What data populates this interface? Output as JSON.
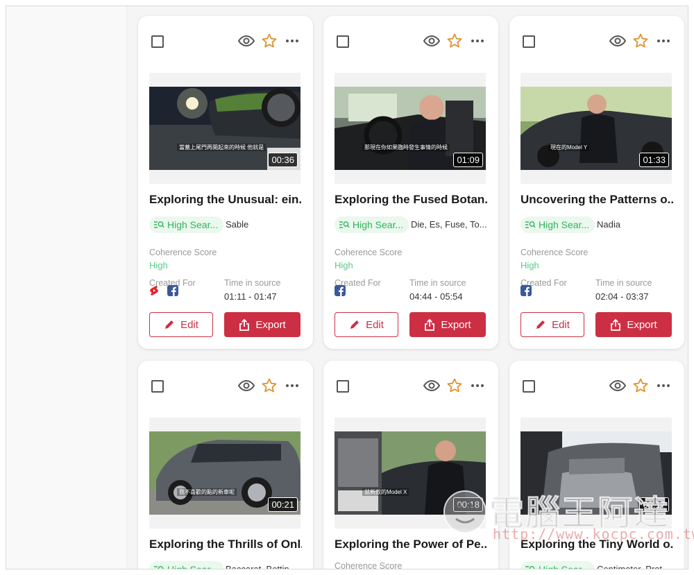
{
  "cards": [
    {
      "duration": "00:36",
      "title": "Exploring the Unusual: ein...",
      "chip_label": "High Sear...",
      "chip_extra": "Sable",
      "coherence_label": "Coherence Score",
      "coherence_value": "High",
      "created_label": "Created For",
      "time_label": "Time in source",
      "time_value": "01:11 - 01:47",
      "edit_label": "Edit",
      "export_label": "Export",
      "subtitle": "當蓋上尾門再開起來的時候 他就是"
    },
    {
      "duration": "01:09",
      "title": "Exploring the Fused Botan...",
      "chip_label": "High Sear...",
      "chip_extra": "Die, Es, Fuse, To...",
      "coherence_label": "Coherence Score",
      "coherence_value": "High",
      "created_label": "Created For",
      "time_label": "Time in source",
      "time_value": "04:44 - 05:54",
      "edit_label": "Edit",
      "export_label": "Export",
      "subtitle": "那現在你如果臨時發生事情的時候"
    },
    {
      "duration": "01:33",
      "title": "Uncovering the Patterns o...",
      "chip_label": "High Sear...",
      "chip_extra": "Nadia",
      "coherence_label": "Coherence Score",
      "coherence_value": "High",
      "created_label": "Created For",
      "time_label": "Time in source",
      "time_value": "02:04 - 03:37",
      "edit_label": "Edit",
      "export_label": "Export",
      "subtitle": "現在的Model Y"
    },
    {
      "duration": "00:21",
      "title": "Exploring the Thrills of Onl...",
      "chip_label": "High Sear...",
      "chip_extra": "Baccarat, Bettin...",
      "subtitle": "我不喜歡的點的新車呢"
    },
    {
      "duration": "00:18",
      "title": "Exploring the Power of Pe...",
      "coherence_label": "Coherence Score",
      "subtitle": "就新款的Model X"
    },
    {
      "duration": "00:17",
      "title": "Exploring the Tiny World o...",
      "chip_label": "High Sear...",
      "chip_extra": "Centimeter, Prot...",
      "subtitle": ""
    }
  ],
  "watermark": {
    "text": "電腦王阿達",
    "url": "http://www.kocpc.com.tw"
  },
  "colors": {
    "accent": "#cc2f44",
    "green": "#2fb45a",
    "chip_bg": "#eaf8ee",
    "star": "#e0912b"
  }
}
